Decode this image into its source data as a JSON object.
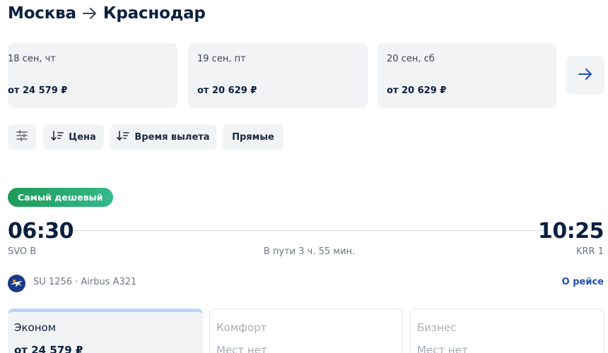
{
  "header": {
    "from": "Москва",
    "to": "Краснодар"
  },
  "date_cards": [
    {
      "date": "18 сен, чт",
      "price": "от 24 579 ₽"
    },
    {
      "date": "19 сен, пт",
      "price": "от 20 629 ₽"
    },
    {
      "date": "20 сен, сб",
      "price": "от 20 629 ₽"
    }
  ],
  "filters": {
    "price_label": "Цена",
    "departure_label": "Время вылета",
    "direct_label": "Прямые"
  },
  "flight": {
    "badge": "Самый дешевый",
    "departure_time": "06:30",
    "arrival_time": "10:25",
    "departure_airport": "SVO B",
    "arrival_airport": "KRR 1",
    "duration": "В пути 3 ч. 55 мин.",
    "flight_info": "SU 1256 · Airbus A321",
    "about_link": "О рейсе"
  },
  "fares": [
    {
      "name": "Эконом",
      "price": "от 24 579 ₽"
    },
    {
      "name": "Комфорт",
      "price": "Мест нет"
    },
    {
      "name": "Бизнес",
      "price": "Мест нет"
    }
  ],
  "colors": {
    "primary_text": "#0b1f3f",
    "link": "#1f4fb3",
    "badge_gradient_start": "#1f9b5a",
    "badge_gradient_end": "#35b98a",
    "card_background": "#f2f3f5"
  },
  "icons": {
    "route_arrow": "arrow-right-icon",
    "next_dates": "arrow-right-icon",
    "filter_settings": "sliders-icon",
    "sort": "sort-descending-icon",
    "airline_logo": "aeroflot-logo"
  }
}
